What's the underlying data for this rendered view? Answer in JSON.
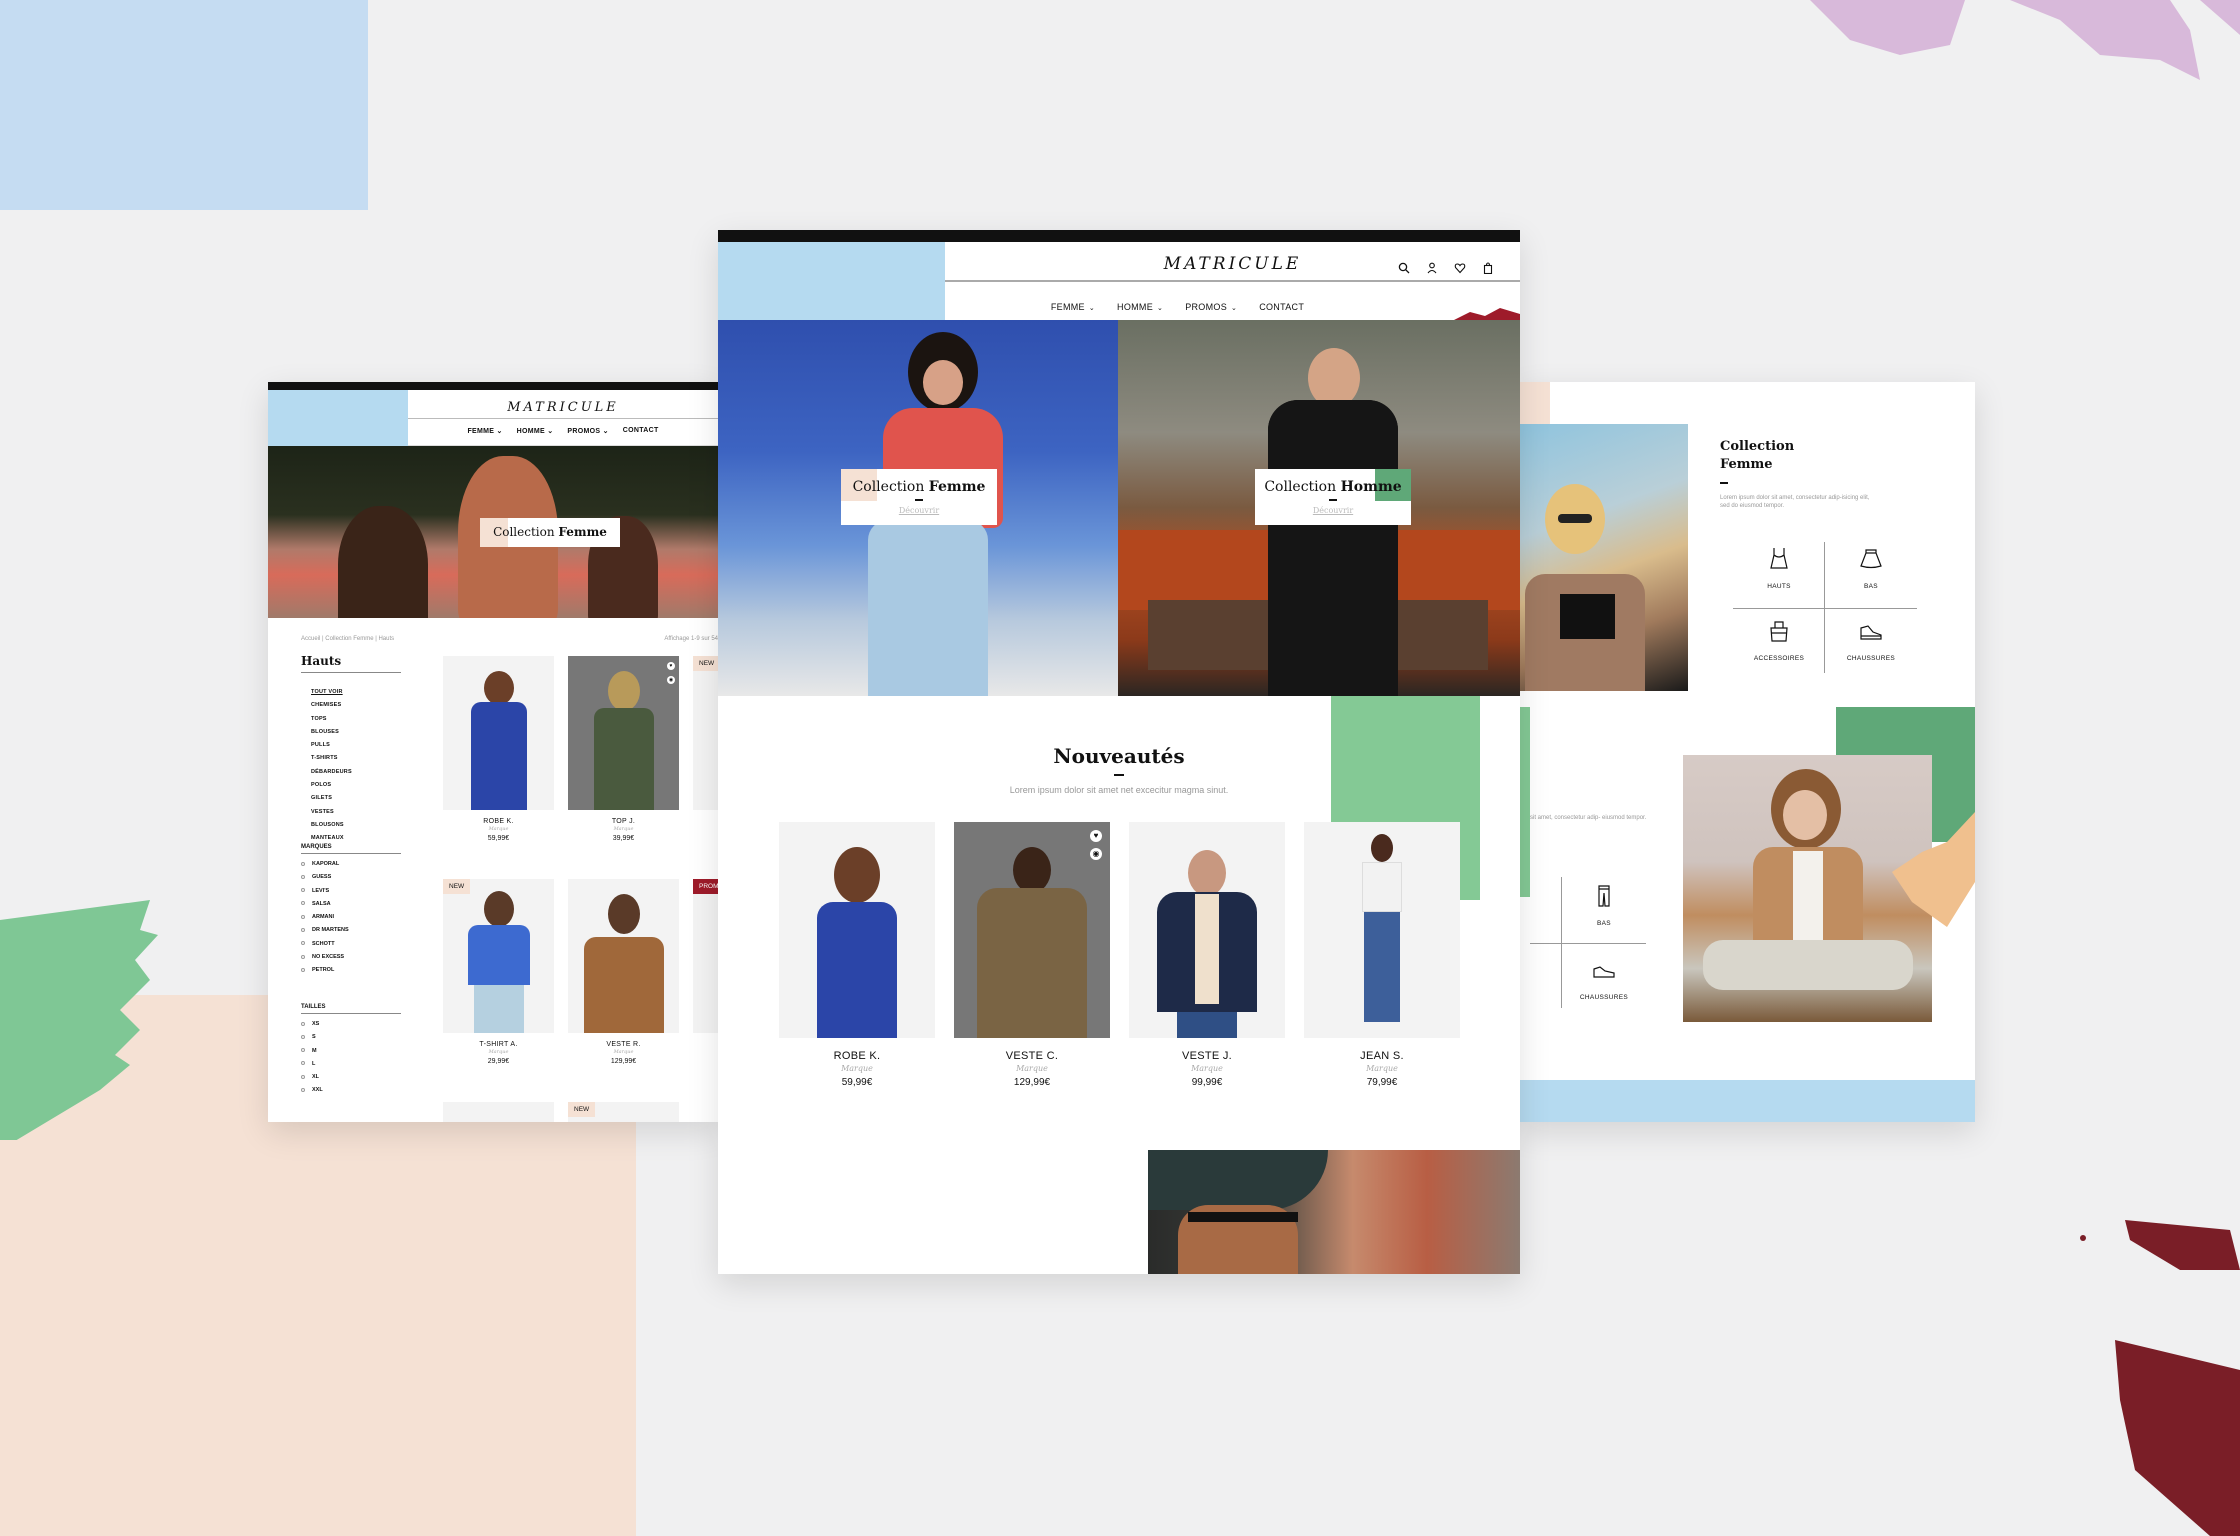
{
  "brand": {
    "logo": "MATRICULE",
    "colors": {
      "light_blue": "#b5daf0",
      "peach": "#f5e1d4",
      "green": "#84c995",
      "dark_green": "#5fa878",
      "burgundy": "#9e1b2a",
      "purple": "#d8b9da",
      "background": "#f0f0f1"
    }
  },
  "nav": {
    "items": [
      {
        "label": "FEMME",
        "has_dropdown": true
      },
      {
        "label": "HOMME",
        "has_dropdown": true
      },
      {
        "label": "PROMOS",
        "has_dropdown": true
      },
      {
        "label": "CONTACT",
        "has_dropdown": false
      }
    ],
    "chevron": "⌄",
    "icons": [
      "search-icon",
      "user-icon",
      "heart-icon",
      "bag-icon"
    ]
  },
  "left_page": {
    "hero_banner": {
      "light": "Collection ",
      "bold": "Femme"
    },
    "breadcrumb": "Accueil | Collection Femme | Hauts",
    "showing": "Affichage 1-9 sur 54",
    "sidebar_title": "Hauts",
    "categories": [
      "TOUT VOIR",
      "CHEMISES",
      "TOPS",
      "BLOUSES",
      "PULLS",
      "T-SHIRTS",
      "DÉBARDEURS",
      "POLOS",
      "GILETS",
      "VESTES",
      "BLOUSONS",
      "MANTEAUX"
    ],
    "brands_title": "MARQUES",
    "brands": [
      "KAPORAL",
      "GUESS",
      "LEVI'S",
      "SALSA",
      "ARMANI",
      "DR MARTENS",
      "SCHOTT",
      "NO EXCESS",
      "PETROL"
    ],
    "sizes_title": "TAILLES",
    "sizes": [
      "XS",
      "S",
      "M",
      "L",
      "XL",
      "XXL"
    ],
    "products": [
      {
        "name": "ROBE K.",
        "brand": "Marque",
        "price": "59,99€",
        "badge": ""
      },
      {
        "name": "TOP J.",
        "brand": "Marque",
        "price": "39,99€",
        "badge": ""
      },
      {
        "name": "",
        "brand": "",
        "price": "",
        "badge": "NEW"
      },
      {
        "name": "T-SHIRT A.",
        "brand": "Marque",
        "price": "29,99€",
        "badge": "NEW"
      },
      {
        "name": "VESTE R.",
        "brand": "Marque",
        "price": "129,99€",
        "badge": ""
      },
      {
        "name": "",
        "brand": "",
        "price": "",
        "badge": "PROMO"
      },
      {
        "name": "",
        "brand": "",
        "price": "",
        "badge": ""
      },
      {
        "name": "",
        "brand": "",
        "price": "",
        "badge": "NEW"
      }
    ]
  },
  "center_page": {
    "hero": [
      {
        "light": "Collection ",
        "bold": "Femme",
        "link": "Découvrir"
      },
      {
        "light": "Collection ",
        "bold": "Homme",
        "link": "Découvrir"
      }
    ],
    "section_title": "Nouveautés",
    "section_subtitle": "Lorem ipsum dolor sit amet net excecitur magma sinut.",
    "products": [
      {
        "name": "ROBE K.",
        "brand": "Marque",
        "price": "59,99€"
      },
      {
        "name": "VESTE C.",
        "brand": "Marque",
        "price": "129,99€"
      },
      {
        "name": "VESTE J.",
        "brand": "Marque",
        "price": "99,99€"
      },
      {
        "name": "JEAN S.",
        "brand": "Marque",
        "price": "79,99€"
      }
    ]
  },
  "right_page": {
    "collection_title_1": "Collection",
    "collection_title_2": "Femme",
    "collection_text": "Lorem ipsum dolor sit amet, consectetur adip-isicing elit, sed do eiusmod tempor.",
    "categories": [
      "HAUTS",
      "BAS",
      "ACCESSOIRES",
      "CHAUSSURES"
    ],
    "fragment_text": "sit amet, consectetur adip- eiusmod tempor.",
    "fragment_categories": [
      "BAS",
      "CHAUSSURES"
    ]
  }
}
